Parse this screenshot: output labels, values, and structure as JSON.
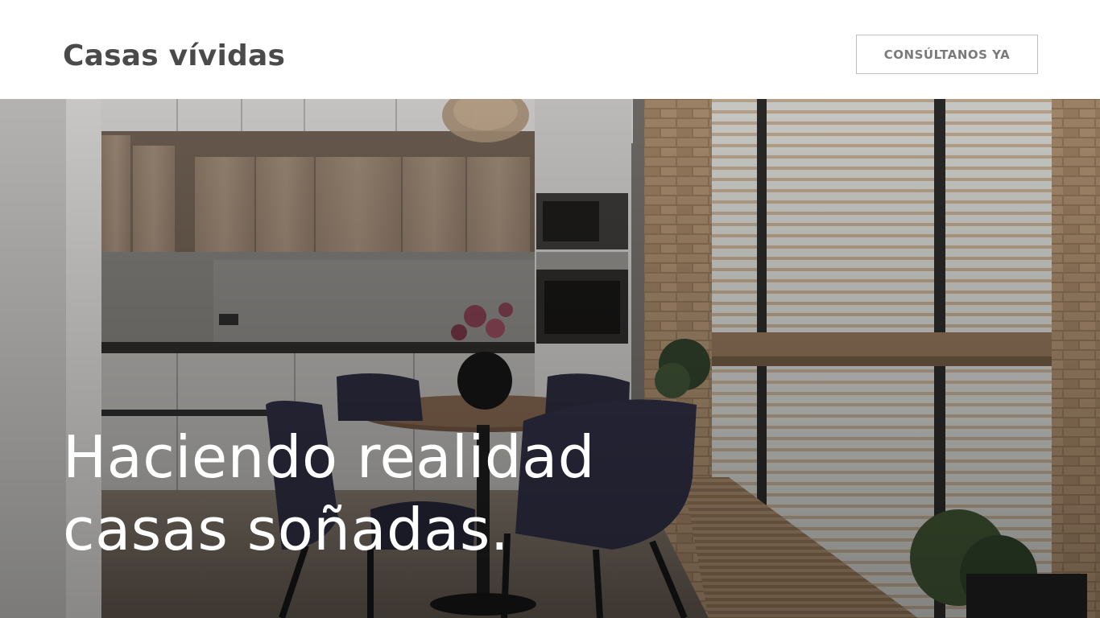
{
  "header": {
    "brand": "Casas vívidas",
    "cta_label": "CONSÚLTANOS YA"
  },
  "hero": {
    "title_line1": "Haciendo realidad",
    "title_line2": "casas soñadas.",
    "image_description_icon": "kitchen-dining-photo"
  },
  "colors": {
    "brand_text": "#4a4a4a",
    "cta_text": "#7a7a7a",
    "cta_border": "#bdbdbd",
    "hero_text": "#ffffff"
  }
}
